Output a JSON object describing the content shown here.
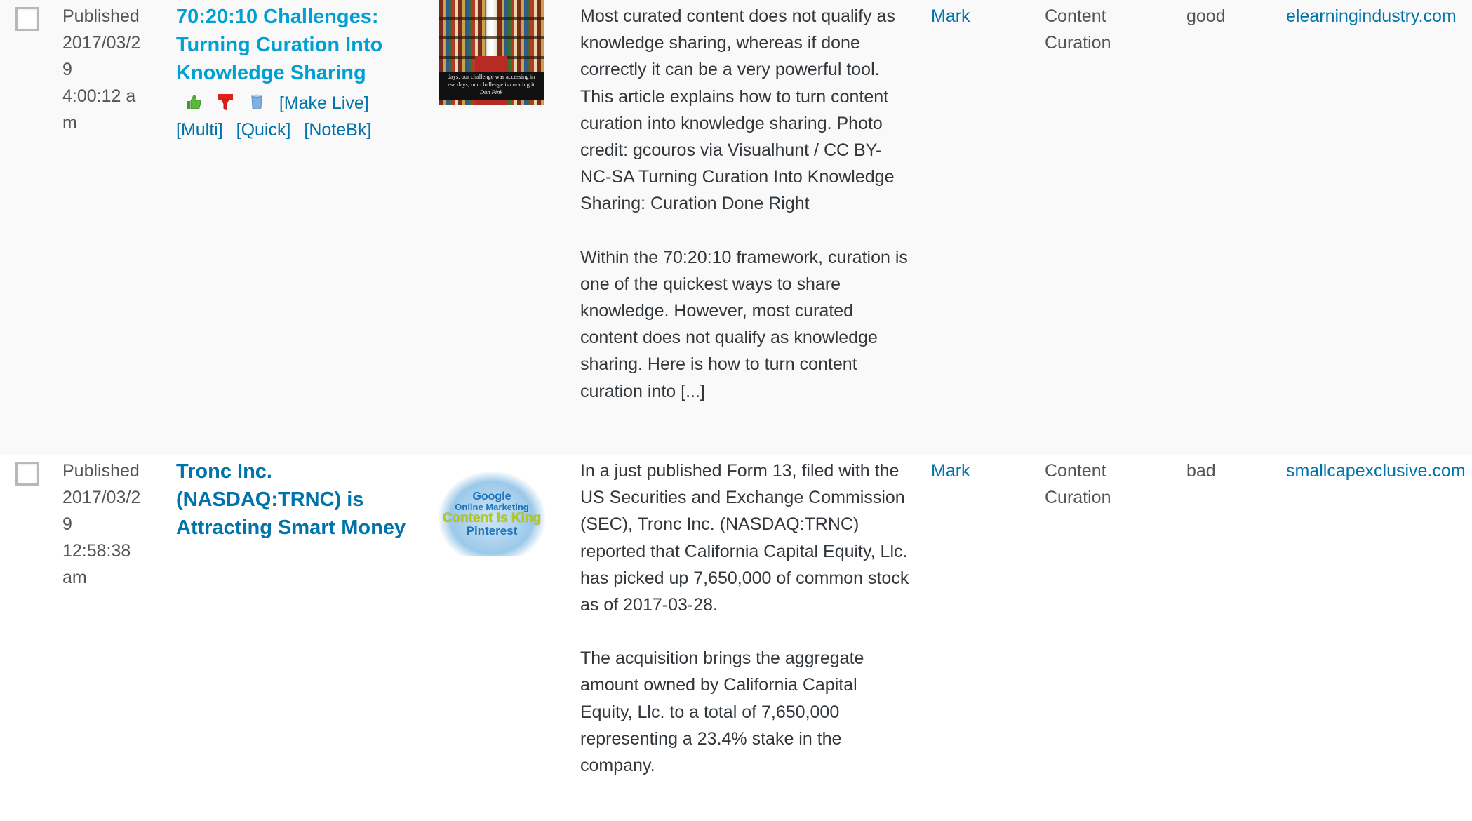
{
  "rows": [
    {
      "status": "Published",
      "date": "2017/03/29",
      "time": "4:00:12 am",
      "title": "70:20:10 Challenges: Turning Curation Into Knowledge Sharing",
      "actions": {
        "icons": [
          "thumbs-up-icon",
          "thumbs-down-icon",
          "trash-can-icon"
        ],
        "make_live": "[Make Live]",
        "multi": "[Multi]",
        "quick": "[Quick]",
        "notebook": "[NoteBk]"
      },
      "thumbnail": {
        "alt": "Library bookshelves with quote",
        "caption_line1": "days, our challenge was accessing in",
        "caption_line2": "ese days, our challenge is curating it",
        "caption_author": "Dan Pink"
      },
      "excerpt": [
        "Most curated content does not qualify as knowledge sharing, whereas if done correctly it can be a very powerful tool. This article explains how to turn content curation into knowledge sharing. Photo credit: gcouros via Visualhunt / CC BY-NC-SA Turning Curation Into Knowledge Sharing: Curation Done Right",
        "Within the 70:20:10 framework, curation is one of the quickest ways to share knowledge. However, most curated content does not qualify as knowledge sharing. Here is how to turn content curation into [...]"
      ],
      "author": "Mark",
      "category": "Content Curation",
      "rating": "good",
      "domain": "elearningindustry.com"
    },
    {
      "status": "Published",
      "date": "2017/03/29",
      "time": "12:58:38 am",
      "title": "Tronc Inc. (NASDAQ:TRNC) is Attracting Smart Money",
      "thumbnail": {
        "alt": "Content Is King word cloud",
        "words": [
          "Google",
          "Online Marketing",
          "Content Is King",
          "Pinterest"
        ]
      },
      "excerpt": [
        "In a just published Form 13, filed with the US Securities and Exchange Commission (SEC), Tronc Inc. (NASDAQ:TRNC) reported that California Capital Equity, Llc. has picked up 7,650,000 of common stock as of 2017-03-28.",
        "The acquisition brings the aggregate amount owned by California Capital Equity, Llc. to a total of 7,650,000 representing a 23.4% stake in the company."
      ],
      "author": "Mark",
      "category": "Content Curation",
      "rating": "bad",
      "domain": "smallcapexclusive.com"
    }
  ],
  "colors": {
    "link": "#0073aa",
    "link_hover": "#00a0d2",
    "text": "#32373c",
    "muted_text": "#555555",
    "alt_row_bg": "#f9f9f9",
    "checkbox_border": "#b4b9be"
  }
}
